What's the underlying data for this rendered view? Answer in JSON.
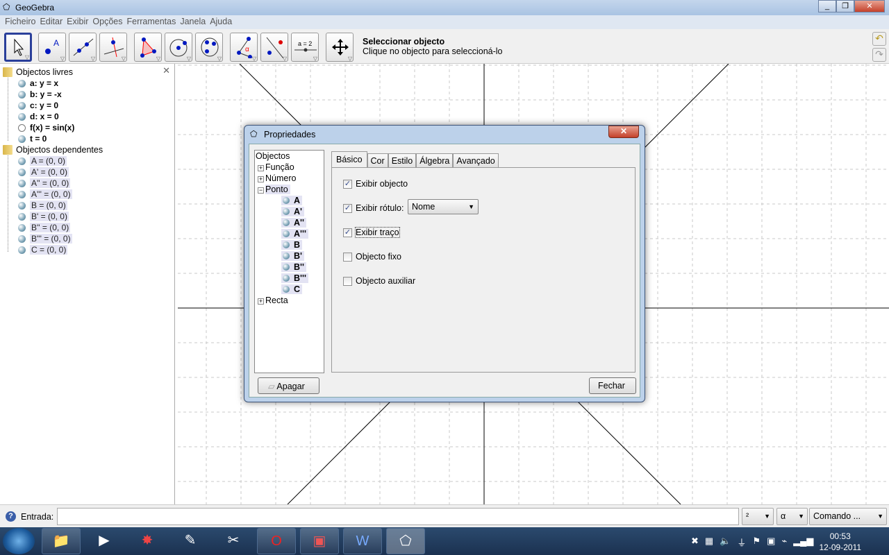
{
  "window": {
    "title": "GeoGebra"
  },
  "menu": [
    "Ficheiro",
    "Editar",
    "Exibir",
    "Opções",
    "Ferramentas",
    "Janela",
    "Ajuda"
  ],
  "toolbar": {
    "tools": [
      "move",
      "point",
      "line-through-two-points",
      "perpendicular-line",
      "polygon",
      "circle-center-point",
      "conic-five-points",
      "angle",
      "reflect-about-line",
      "slider",
      "move-graphics-view"
    ],
    "help_title": "Seleccionar objecto",
    "help_text": "Clique no objecto para seleccioná-lo"
  },
  "algebra": {
    "free_label": "Objectos livres",
    "free": [
      {
        "text": "a: y = x"
      },
      {
        "text": "b: y = -x"
      },
      {
        "text": "c: y = 0"
      },
      {
        "text": "d: x = 0"
      },
      {
        "text": "f(x) = sin(x)",
        "hidden": true
      },
      {
        "text": "t = 0"
      }
    ],
    "dependent_label": "Objectos dependentes",
    "dependent": [
      "A = (0, 0)",
      "A' = (0, 0)",
      "A'' = (0, 0)",
      "A''' = (0, 0)",
      "B = (0, 0)",
      "B' = (0, 0)",
      "B'' = (0, 0)",
      "B''' = (0, 0)",
      "C = (0, 0)"
    ]
  },
  "dialog": {
    "title": "Propriedades",
    "tree_root": "Objectos",
    "tree": [
      "Função",
      "Número",
      "Ponto",
      "Recta"
    ],
    "points": [
      "A",
      "A'",
      "A''",
      "A'''",
      "B",
      "B'",
      "B''",
      "B'''",
      "C"
    ],
    "tabs": [
      "Básico",
      "Cor",
      "Estilo",
      "Álgebra",
      "Avançado"
    ],
    "options": [
      {
        "label": "Exibir objecto",
        "checked": true
      },
      {
        "label": "Exibir rótulo:",
        "checked": true
      },
      {
        "label": "Exibir traço",
        "checked": true
      },
      {
        "label": "Objecto fixo",
        "checked": false
      },
      {
        "label": "Objecto auxiliar",
        "checked": false
      }
    ],
    "label_mode": "Nome",
    "delete": "Apagar",
    "close": "Fechar"
  },
  "input": {
    "label": "Entrada:",
    "value": "",
    "sup": "²",
    "greek": "α",
    "command": "Comando ..."
  },
  "taskbar": {
    "time": "00:53",
    "date": "12-09-2011"
  }
}
